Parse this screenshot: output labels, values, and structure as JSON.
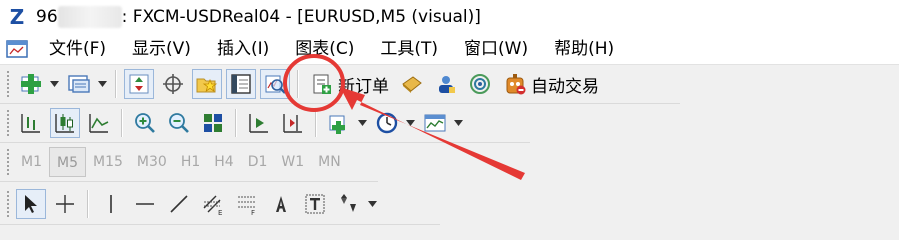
{
  "window": {
    "title_prefix": "96",
    "title_text": ": FXCM-USDReal04 - [EURUSD,M5 (visual)]"
  },
  "menu": {
    "items": [
      "文件(F)",
      "显示(V)",
      "插入(I)",
      "图表(C)",
      "工具(T)",
      "窗口(W)",
      "帮助(H)"
    ]
  },
  "toolbar1": {
    "new_order_label": "新订单",
    "auto_trading_label": "自动交易"
  },
  "timeframes": {
    "items": [
      "M1",
      "M5",
      "M15",
      "M30",
      "H1",
      "H4",
      "D1",
      "W1",
      "MN"
    ],
    "selected": "M5"
  },
  "colors": {
    "annotation": "#e53935",
    "accent": "#1d4fa3"
  },
  "icons": {
    "highlighted": "strategy-tester-icon"
  }
}
